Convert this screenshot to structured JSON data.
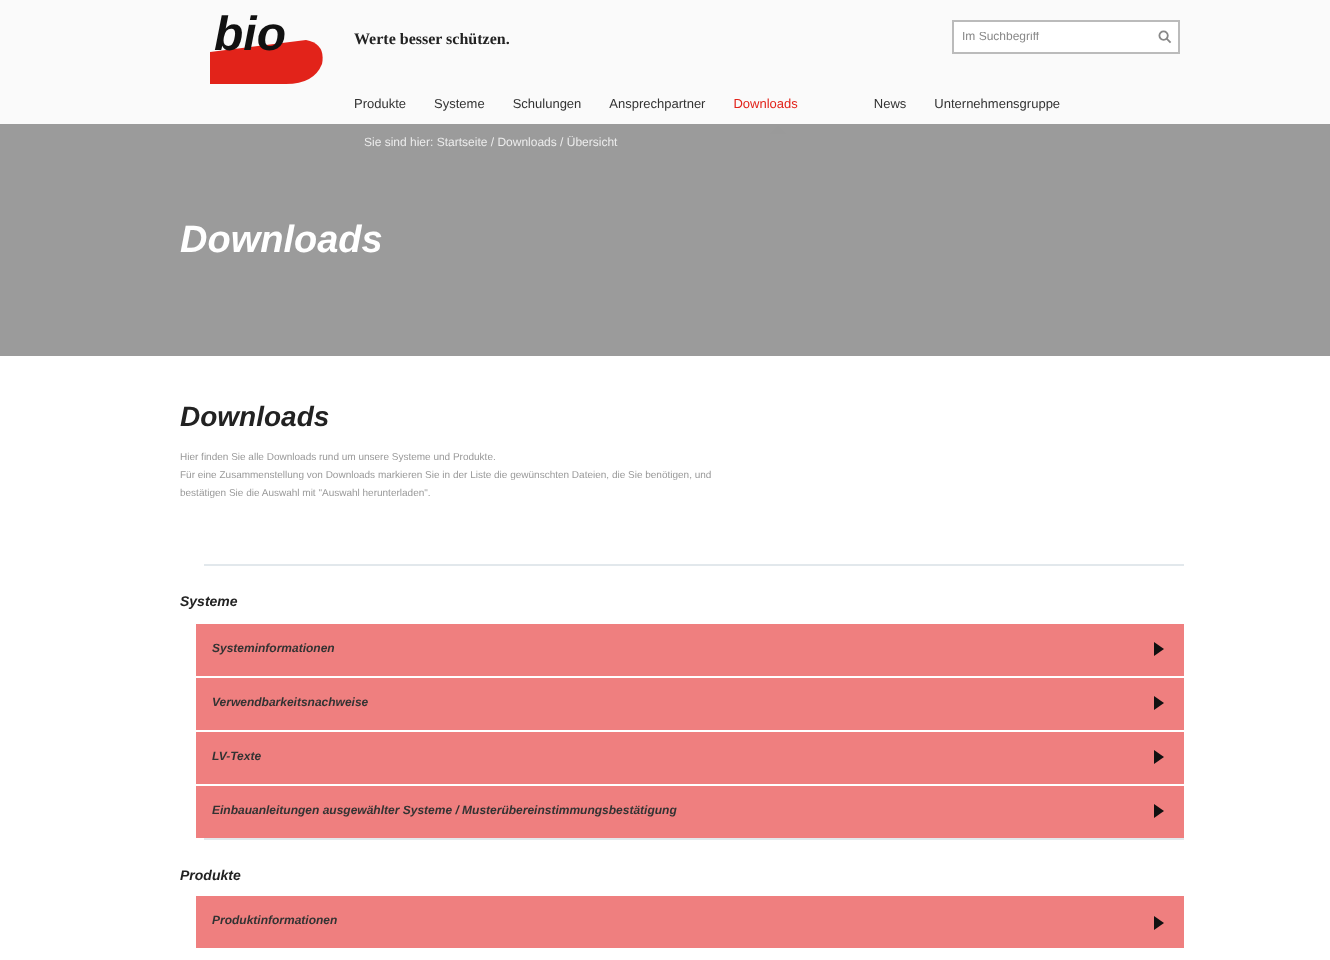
{
  "header": {
    "logo": "bio",
    "tagline": "Werte besser schützen.",
    "search": {
      "placeholder": "Im Suchbegriff"
    }
  },
  "nav": [
    {
      "label": "Produkte",
      "selected": false
    },
    {
      "label": "Systeme",
      "selected": false
    },
    {
      "label": "Schulungen",
      "selected": false
    },
    {
      "label": "Ansprechpartner",
      "selected": false
    },
    {
      "label": "Downloads",
      "selected": true
    },
    {
      "label": "News",
      "selected": false
    },
    {
      "label": "Unternehmensgruppe",
      "selected": false
    }
  ],
  "banner": {
    "breadcrumb": "Sie sind hier: Startseite / Downloads / Übersicht",
    "title": "Downloads"
  },
  "content": {
    "title": "Downloads",
    "intro": [
      "Hier finden Sie alle Downloads rund um unsere Systeme und Produkte.",
      "Für eine Zusammenstellung von Downloads markieren Sie in der Liste die gewünschten Dateien, die Sie benötigen, und",
      "bestätigen Sie die Auswahl mit \"Auswahl herunterladen\"."
    ]
  },
  "sections": [
    {
      "title": "Systeme",
      "items": [
        "Systeminformationen",
        "Verwendbarkeitsnachweise",
        "LV-Texte",
        "Einbauanleitungen ausgewählter Systeme / Musterübereinstimmungsbestätigung"
      ]
    },
    {
      "title": "Produkte",
      "items": [
        "Produktinformationen"
      ]
    }
  ]
}
